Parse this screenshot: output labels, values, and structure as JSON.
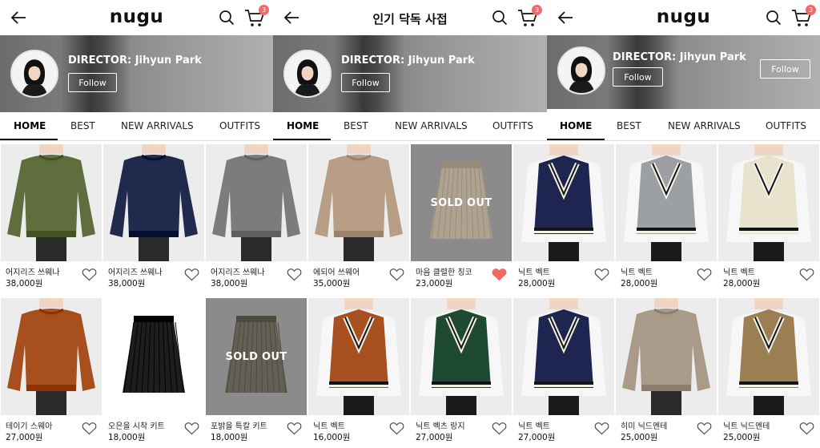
{
  "screens": [
    {
      "title": "nugu",
      "title_style": "logo",
      "cart_count": "3"
    },
    {
      "title": "인기 닥독 사접",
      "title_style": "text",
      "cart_count": "3"
    },
    {
      "title": "nugu",
      "title_style": "logo",
      "cart_count": "3"
    }
  ],
  "director": {
    "name": "DIRECTOR: Jihyun Park",
    "follow_label": "Follow"
  },
  "tabs": [
    "HOME",
    "BEST",
    "NEW ARRIVALS",
    "OUTFITS"
  ],
  "active_tab": "HOME",
  "sold_out_label": "SOLD OUT",
  "colors": {
    "badge": "#ef6a6a",
    "heart_filled": "#f06a6a",
    "text": "#111111"
  },
  "products": [
    {
      "name": "어지리즈 쓰웨나",
      "price": "38,000원",
      "sold_out": false,
      "liked": false,
      "item": "sweater",
      "color": "#5f6e3c"
    },
    {
      "name": "어지리즈 쓰웨나",
      "price": "38,000원",
      "sold_out": false,
      "liked": false,
      "item": "sweater",
      "color": "#1f2a4d"
    },
    {
      "name": "어지리즈 쓰웨나",
      "price": "38,000원",
      "sold_out": false,
      "liked": false,
      "item": "sweater",
      "color": "#7b7c7c"
    },
    {
      "name": "에되어 쓰웨어",
      "price": "35,000원",
      "sold_out": false,
      "liked": false,
      "item": "sweater",
      "color": "#b79e84"
    },
    {
      "name": "마음 클렬한 칭코",
      "price": "23,000원",
      "sold_out": true,
      "liked": true,
      "item": "skirt",
      "color": "#b9a893"
    },
    {
      "name": "닉트 벡트",
      "price": "28,000원",
      "sold_out": false,
      "liked": false,
      "item": "vest",
      "color": "#1d2550"
    },
    {
      "name": "닉트 벡트",
      "price": "28,000원",
      "sold_out": false,
      "liked": false,
      "item": "vest",
      "color": "#9ca0a3"
    },
    {
      "name": "닉트 벡트",
      "price": "28,000원",
      "sold_out": false,
      "liked": false,
      "item": "vest",
      "color": "#e9e2cc"
    },
    {
      "name": "테이기 스웨아",
      "price": "27,000원",
      "sold_out": false,
      "liked": false,
      "item": "sweater",
      "color": "#a84f1e"
    },
    {
      "name": "오은을 시착 키트",
      "price": "18,000원",
      "sold_out": false,
      "liked": false,
      "item": "skirt",
      "color": "#1e1e1e"
    },
    {
      "name": "포밝을 특칼 키트",
      "price": "18,000원",
      "sold_out": true,
      "liked": false,
      "item": "skirt",
      "color": "#5a5548"
    },
    {
      "name": "닉트 벡트",
      "price": "16,000원",
      "sold_out": false,
      "liked": false,
      "item": "vest",
      "color": "#a8501f"
    },
    {
      "name": "닉트 벡츠 랑지",
      "price": "27,000원",
      "sold_out": false,
      "liked": false,
      "item": "vest",
      "color": "#1f4a32"
    },
    {
      "name": "닉트 벡트",
      "price": "27,000원",
      "sold_out": false,
      "liked": false,
      "item": "vest",
      "color": "#1d2550"
    },
    {
      "name": "히미 닉드멘테",
      "price": "25,000원",
      "sold_out": false,
      "liked": false,
      "item": "sweater",
      "color": "#a99a8a"
    },
    {
      "name": "닉트 닉드멘테",
      "price": "25,000원",
      "sold_out": false,
      "liked": false,
      "item": "vest",
      "color": "#9b7f52"
    }
  ]
}
